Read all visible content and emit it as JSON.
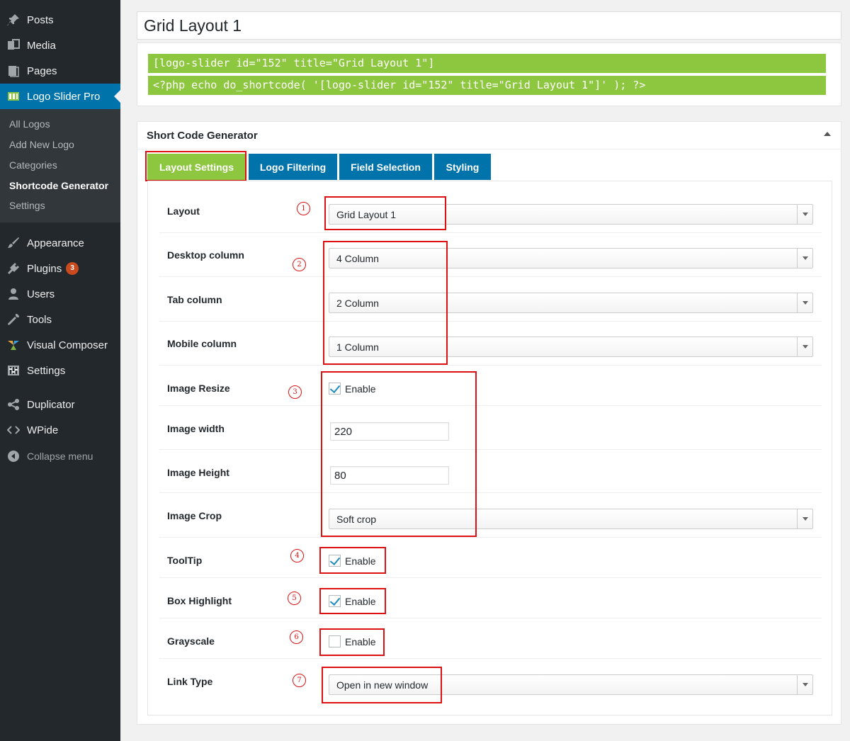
{
  "sidebar": {
    "items_top": [
      {
        "label": "Posts",
        "icon": "pin-icon"
      },
      {
        "label": "Media",
        "icon": "media-icon"
      },
      {
        "label": "Pages",
        "icon": "pages-icon"
      },
      {
        "label": "Logo Slider Pro",
        "icon": "logo-slider-icon"
      }
    ],
    "submenu": [
      "All Logos",
      "Add New Logo",
      "Categories",
      "Shortcode Generator",
      "Settings"
    ],
    "items_bottom": [
      {
        "label": "Appearance",
        "icon": "paintbrush-icon"
      },
      {
        "label": "Plugins",
        "icon": "plugin-icon",
        "badge": "3"
      },
      {
        "label": "Users",
        "icon": "users-icon"
      },
      {
        "label": "Tools",
        "icon": "wrench-icon"
      },
      {
        "label": "Visual Composer",
        "icon": "visual-composer-icon"
      },
      {
        "label": "Settings",
        "icon": "settings-icon"
      },
      {
        "label": "Duplicator",
        "icon": "share-icon"
      },
      {
        "label": "WPide",
        "icon": "code-icon"
      }
    ],
    "collapse": "Collapse menu"
  },
  "post_title": "Grid Layout 1",
  "shortcodes": [
    "[logo-slider id=\"152\" title=\"Grid Layout 1\"]",
    "<?php echo do_shortcode( '[logo-slider id=\"152\" title=\"Grid Layout 1\"]' ); ?>"
  ],
  "generator": {
    "title": "Short Code Generator",
    "tabs": [
      "Layout Settings",
      "Logo Filtering",
      "Field Selection",
      "Styling"
    ],
    "fields": {
      "layout": {
        "label": "Layout",
        "value": "Grid Layout 1"
      },
      "desktop_column": {
        "label": "Desktop column",
        "value": "4 Column"
      },
      "tab_column": {
        "label": "Tab column",
        "value": "2 Column"
      },
      "mobile_column": {
        "label": "Mobile column",
        "value": "1 Column"
      },
      "image_resize": {
        "label": "Image Resize",
        "option": "Enable",
        "checked": true
      },
      "image_width": {
        "label": "Image width",
        "value": "220"
      },
      "image_height": {
        "label": "Image Height",
        "value": "80"
      },
      "image_crop": {
        "label": "Image Crop",
        "value": "Soft crop"
      },
      "tooltip": {
        "label": "ToolTip",
        "option": "Enable",
        "checked": true
      },
      "box_highlight": {
        "label": "Box Highlight",
        "option": "Enable",
        "checked": true
      },
      "grayscale": {
        "label": "Grayscale",
        "option": "Enable",
        "checked": false
      },
      "link_type": {
        "label": "Link Type",
        "value": "Open in new window"
      }
    }
  },
  "annotations": [
    "1",
    "2",
    "3",
    "4",
    "5",
    "6",
    "7"
  ],
  "colors": {
    "accent_green": "#8dc63f",
    "wp_blue": "#0073aa",
    "annotation_red": "#d11111"
  }
}
